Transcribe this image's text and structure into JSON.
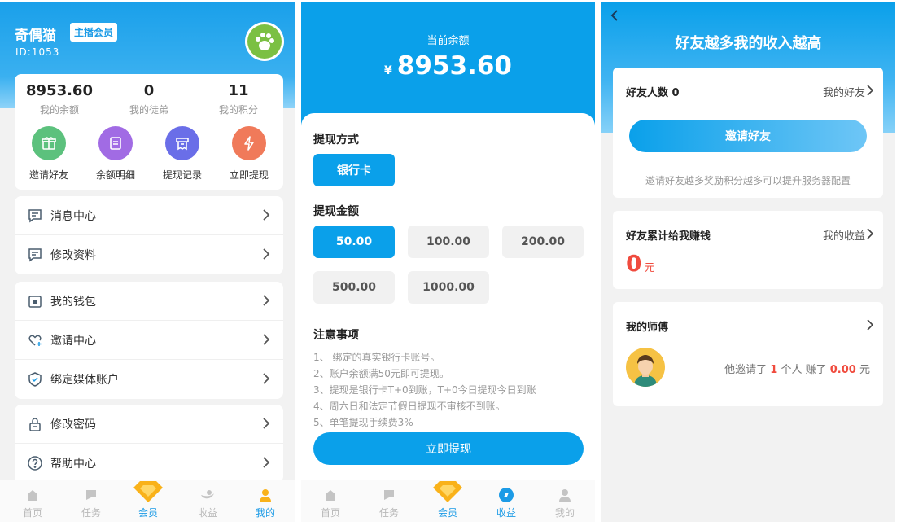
{
  "member": {
    "name": "奇偶猫",
    "badge": "主播会员",
    "id": "ID:1053",
    "stats": [
      {
        "value": "8953.60",
        "label": "我的余额"
      },
      {
        "value": "0",
        "label": "我的徒弟"
      },
      {
        "value": "11",
        "label": "我的积分"
      }
    ],
    "quick": [
      {
        "label": "邀请好友",
        "color": "#5cc17d",
        "icon": "gift-icon"
      },
      {
        "label": "余额明细",
        "color": "#a16be4",
        "icon": "list-icon"
      },
      {
        "label": "提现记录",
        "color": "#6a6ee8",
        "icon": "receipt-icon"
      },
      {
        "label": "立即提现",
        "color": "#f07a5a",
        "icon": "lightning-icon"
      }
    ],
    "menu_group1": [
      "消息中心",
      "修改资料"
    ],
    "menu_group2": [
      "我的钱包",
      "邀请中心",
      "绑定媒体账户"
    ],
    "menu_group3": [
      "修改密码",
      "帮助中心"
    ]
  },
  "tabbar": {
    "items": [
      "首页",
      "任务",
      "会员",
      "收益",
      "我的"
    ],
    "active_color": "#1c9be6"
  },
  "withdraw": {
    "balance_label": "当前余额",
    "currency": "¥",
    "balance": "8953.60",
    "method_title": "提现方式",
    "method": "银行卡",
    "amount_title": "提现金额",
    "amounts": [
      "50.00",
      "100.00",
      "200.00",
      "500.00",
      "1000.00"
    ],
    "notes_title": "注意事项",
    "notes": [
      "1、 绑定的真实银行卡账号。",
      "2、账户余额满50元即可提现。",
      "3、提现是银行卡T+0到账，T+0今日提现今日到账",
      "4、周六日和法定节假日提现不审核不到账。",
      "5、单笔提现手续费3%"
    ],
    "submit": "立即提现"
  },
  "friends": {
    "title": "好友越多我的收入越高",
    "friend_count_label": "好友人数 0",
    "my_friends_link": "我的好友",
    "invite_button": "邀请好友",
    "invite_tip": "邀请好友越多奖励积分越多可以提升服务器配置",
    "earn_title": "好友累计给我赚钱",
    "my_earnings_link": "我的收益",
    "earn_value": "0",
    "earn_unit": "元",
    "master_title": "我的师傅",
    "master_pre": "他邀请了",
    "master_people": "1",
    "master_mid": "个人 赚了",
    "master_amount": "0.00",
    "master_unit": "元"
  }
}
